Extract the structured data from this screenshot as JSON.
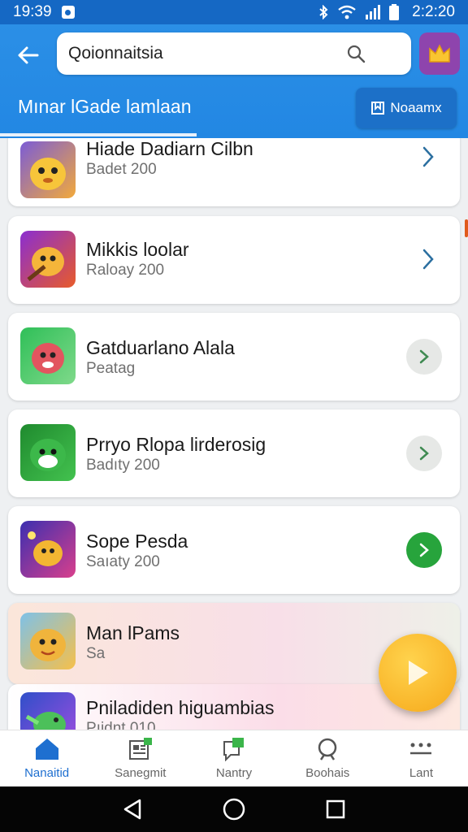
{
  "status_bar": {
    "time": "19:39",
    "clock_right": "2:2:20"
  },
  "app_bar": {
    "search_value": "Qoionnaitsia",
    "title": "Mınar lGade lamlaan",
    "bookmark_label": "Noaamx"
  },
  "colors": {
    "primary": "#2287e3",
    "accent_green": "#27a43c",
    "fab": "#f6a81a",
    "crown_bg": "#8e44ad"
  },
  "items": [
    {
      "name": "Hiade Dadiarn Cilbn",
      "sub": "Badet 200",
      "action": "chevron-right-icon"
    },
    {
      "name": "Mikkis loolar",
      "sub": "Raloay 200",
      "action": "chevron-right-icon"
    },
    {
      "name": "Gatduarlano Alala",
      "sub": "Peatag",
      "action": "chevron-circle-grey"
    },
    {
      "name": "Prryo Rlopa lirderosig",
      "sub": "Badıty 200",
      "action": "chevron-circle-grey"
    },
    {
      "name": "Sope Pesda",
      "sub": "Saıaty 200",
      "action": "chevron-circle-green"
    },
    {
      "name": "Man lPams",
      "sub": "Sa",
      "action": ""
    },
    {
      "name": "Pniladiden higuambias",
      "sub": "Pıidnt 010",
      "action": ""
    }
  ],
  "bottom_nav": [
    {
      "label": "Nanaitid",
      "icon": "home-icon",
      "active": true
    },
    {
      "label": "Sanegmit",
      "icon": "news-icon",
      "active": false
    },
    {
      "label": "Nantry",
      "icon": "chat-icon",
      "active": false
    },
    {
      "label": "Boohais",
      "icon": "profile-icon",
      "active": false
    },
    {
      "label": "Lant",
      "icon": "more-icon",
      "active": false
    }
  ]
}
